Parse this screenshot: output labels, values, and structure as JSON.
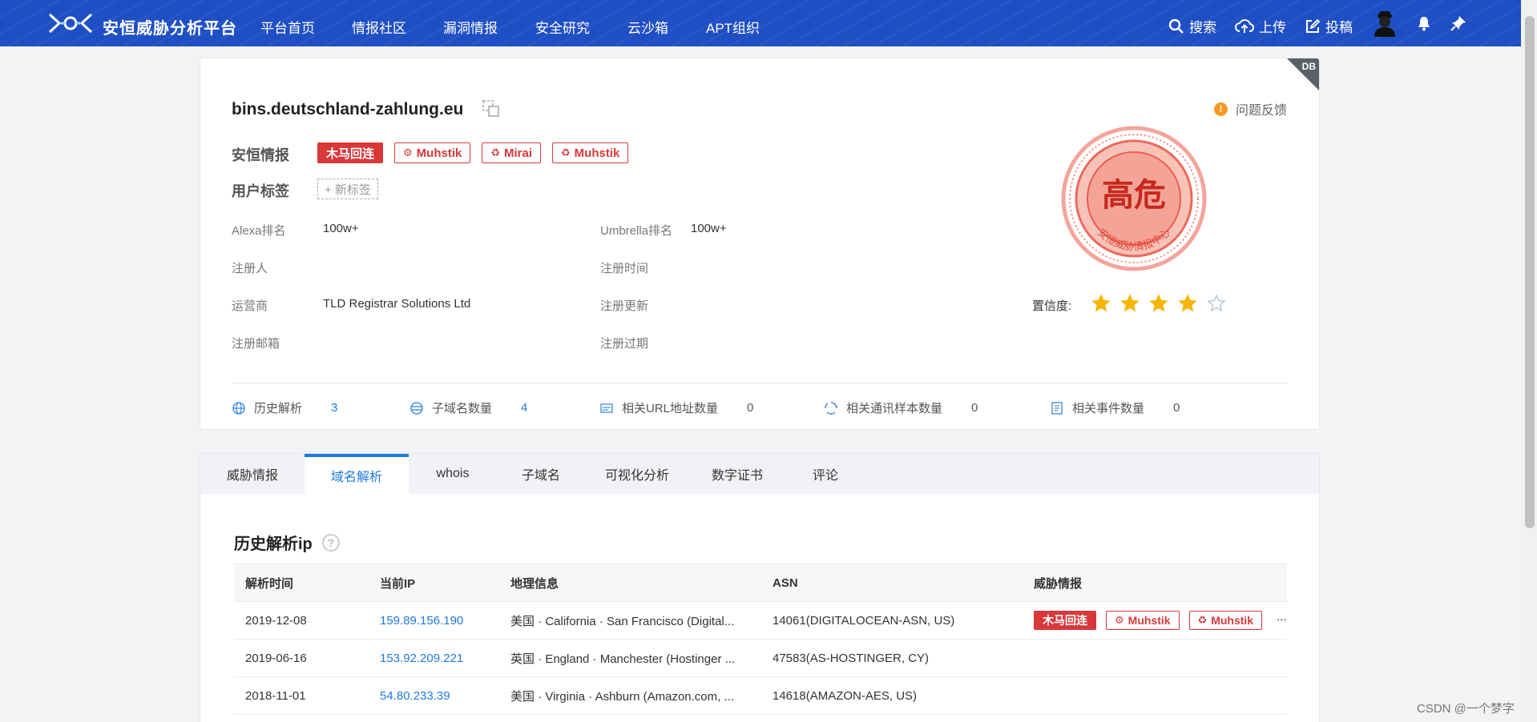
{
  "nav": {
    "brand": "安恒威胁分析平台",
    "items": [
      "平台首页",
      "情报社区",
      "漏洞情报",
      "安全研究",
      "云沙箱",
      "APT组织"
    ],
    "search": "搜索",
    "upload": "上传",
    "submit": "投稿"
  },
  "domain": {
    "name": "bins.deutschland-zahlung.eu",
    "feedback": "问题反馈",
    "intel_label": "安恒情报",
    "intel_tags": [
      {
        "text": "木马回连",
        "icon": ""
      },
      {
        "text": "Muhstik",
        "icon": "bug-icon"
      },
      {
        "text": "Mirai",
        "icon": "recycle-icon"
      },
      {
        "text": "Muhstik",
        "icon": "recycle-icon"
      }
    ],
    "user_tag_label": "用户标签",
    "new_tag": "+ 新标签",
    "corner_text": "DB"
  },
  "info": {
    "alexa_label": "Alexa排名",
    "alexa_value": "100w+",
    "umbrella_label": "Umbrella排名",
    "umbrella_value": "100w+",
    "registrant_label": "注册人",
    "registrant_value": "",
    "reg_time_label": "注册时间",
    "reg_time_value": "",
    "operator_label": "运营商",
    "operator_value": "TLD Registrar Solutions Ltd",
    "reg_update_label": "注册更新",
    "reg_update_value": "",
    "email_label": "注册邮箱",
    "email_value": "",
    "reg_expire_label": "注册过期",
    "reg_expire_value": ""
  },
  "risk": {
    "level": "高危",
    "seal_text": "安恒威胁情报中心",
    "confidence_label": "置信度:",
    "confidence": 4,
    "confidence_max": 5,
    "color": "#e94a3f"
  },
  "stats": [
    {
      "label": "历史解析",
      "value": "3",
      "icon": "globe-icon",
      "link": true
    },
    {
      "label": "子域名数量",
      "value": "4",
      "icon": "subdomain-icon",
      "link": true
    },
    {
      "label": "相关URL地址数量",
      "value": "0",
      "icon": "url-icon",
      "link": false
    },
    {
      "label": "相关通讯样本数量",
      "value": "0",
      "icon": "sample-icon",
      "link": false
    },
    {
      "label": "相关事件数量",
      "value": "0",
      "icon": "event-icon",
      "link": false
    }
  ],
  "tabs": [
    "威胁情报",
    "域名解析",
    "whois",
    "子域名",
    "可视化分析",
    "数字证书",
    "评论"
  ],
  "active_tab": 1,
  "section": {
    "title": "历史解析ip",
    "help": "?"
  },
  "table": {
    "headers": [
      "解析时间",
      "当前IP",
      "地理信息",
      "ASN",
      "威胁情报"
    ],
    "rows": [
      {
        "time": "2019-12-08",
        "ip": "159.89.156.190",
        "geo": "美国 · California · San Francisco (Digital...",
        "asn": "14061(DIGITALOCEAN-ASN, US)",
        "tags": [
          "木马回连",
          "Muhstik",
          "Muhstik"
        ],
        "more": "..."
      },
      {
        "time": "2019-06-16",
        "ip": "153.92.209.221",
        "geo": "英国 · England · Manchester (Hostinger ...",
        "asn": "47583(AS-HOSTINGER, CY)",
        "tags": [],
        "more": ""
      },
      {
        "time": "2018-11-01",
        "ip": "54.80.233.39",
        "geo": "美国 · Virginia · Ashburn (Amazon.com, ...",
        "asn": "14618(AMAZON-AES, US)",
        "tags": [],
        "more": ""
      }
    ]
  },
  "watermark": "CSDN @一个梦字"
}
